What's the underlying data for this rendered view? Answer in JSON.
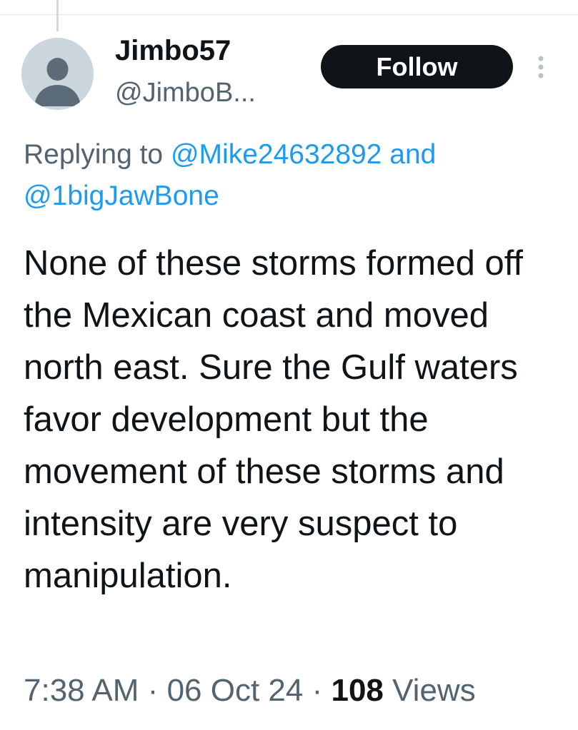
{
  "tweet": {
    "author": {
      "display_name": "Jimbo57",
      "handle": "@JimboB..."
    },
    "follow_label": "Follow",
    "more_icon": "vertical-dots-icon",
    "avatar_icon": "default-profile-icon",
    "reply_context": {
      "prefix": "Replying to",
      "mention_1": "@Mike24632892",
      "conjunction": "and",
      "mention_2": "@1bigJawBone"
    },
    "text": "None of these storms formed off the Mexican coast and moved north east. Sure the Gulf waters favor development but the movement of these storms and intensity are very suspect to manipulation.",
    "time": "7:38 AM",
    "separator": "·",
    "date": "06 Oct 24",
    "views_count": "108",
    "views_label": "Views"
  },
  "colors": {
    "text_primary": "#0f1419",
    "text_secondary": "#536471",
    "link": "#1d9bf0",
    "follow_bg": "#0f1419",
    "avatar_bg": "#ccd6dd",
    "avatar_figure": "#5b6b78"
  }
}
